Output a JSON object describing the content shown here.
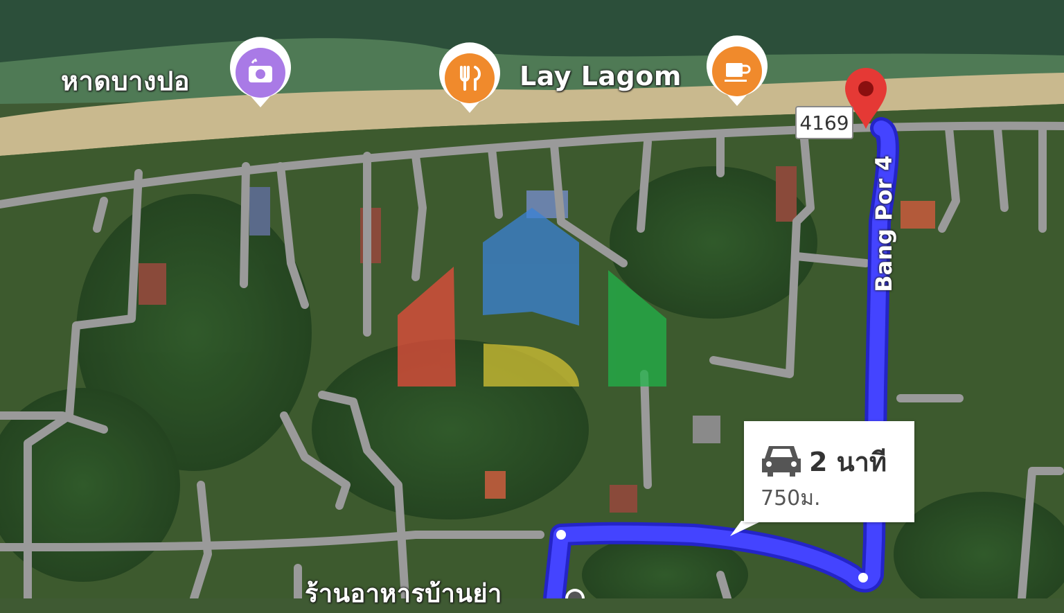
{
  "map": {
    "pois": [
      {
        "id": "beach",
        "name": "หาดบางปอ",
        "icon": "camera-icon",
        "color": "#a97ae6"
      },
      {
        "id": "restaurant",
        "name": "",
        "icon": "restaurant-icon",
        "color": "#f08a2c"
      },
      {
        "id": "cafe",
        "name": "Lay Lagom",
        "icon": "cafe-icon",
        "color": "#f08a2c"
      },
      {
        "id": "bottom-restaurant",
        "name": "ร้านอาหารบ้านย่า",
        "icon": "restaurant-icon",
        "color": "#f08a2c"
      }
    ],
    "route_shield": "4169",
    "road_label": "Bang Por 4",
    "route": {
      "mode_icon": "car-icon",
      "duration": "2 นาที",
      "distance": "750ม.",
      "color": "#3b3bff"
    },
    "destination_pin_color": "#e53935",
    "watermark": {
      "colors": [
        "#e74c3c",
        "#3b82d6",
        "#d4c234",
        "#22b34a"
      ]
    }
  }
}
